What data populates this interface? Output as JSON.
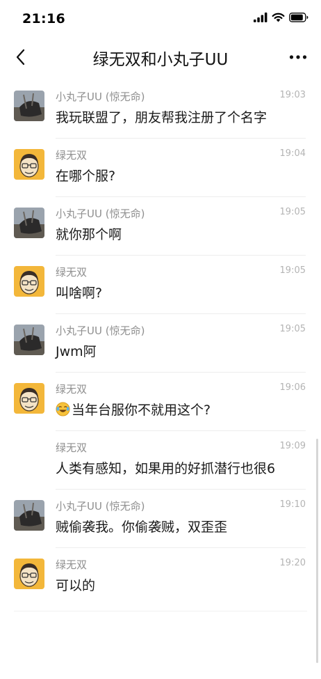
{
  "status": {
    "time": "21:16"
  },
  "header": {
    "title": "绿无双和小丸子UU"
  },
  "messages": [
    {
      "sender": "小丸子UU (惊无命)",
      "time": "19:03",
      "text": "我玩联盟了，朋友帮我注册了个名字",
      "avatar": "photo"
    },
    {
      "sender": "绿无双",
      "time": "19:04",
      "text": "在哪个服?",
      "avatar": "cartoon"
    },
    {
      "sender": "小丸子UU (惊无命)",
      "time": "19:05",
      "text": "就你那个啊",
      "avatar": "photo"
    },
    {
      "sender": "绿无双",
      "time": "19:05",
      "text": "叫啥啊?",
      "avatar": "cartoon"
    },
    {
      "sender": "小丸子UU (惊无命)",
      "time": "19:05",
      "text": "Jwm阿",
      "avatar": "photo"
    },
    {
      "sender": "绿无双",
      "time": "19:06",
      "text": "当年台服你不就用这个?",
      "avatar": "cartoon",
      "emoji": "laugh-cry-emoji"
    },
    {
      "sender": "绿无双",
      "time": "19:09",
      "text": "人类有感知，如果用的好抓潜行也很6",
      "avatar": "none"
    },
    {
      "sender": "小丸子UU (惊无命)",
      "time": "19:10",
      "text": "贼偷袭我。你偷袭贼，双歪歪",
      "avatar": "photo"
    },
    {
      "sender": "绿无双",
      "time": "19:20",
      "text": "可以的",
      "avatar": "cartoon"
    }
  ],
  "icons": {
    "back": "back-chevron-icon",
    "more": "more-dots-icon",
    "signal": "signal-icon",
    "wifi": "wifi-icon",
    "battery": "battery-icon"
  }
}
